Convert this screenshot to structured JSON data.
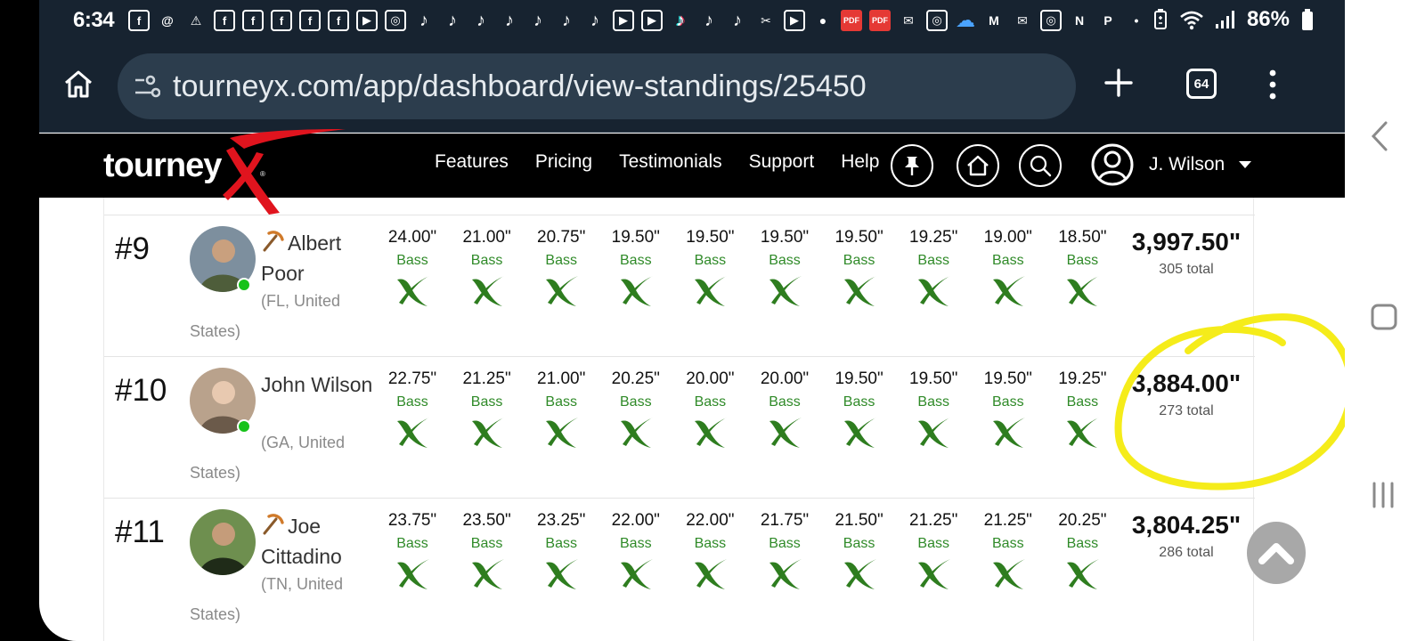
{
  "status_bar": {
    "time": "6:34",
    "battery_percent": "86%",
    "notification_icons": [
      "facebook-icon",
      "threads-icon",
      "warning-icon",
      "facebook-icon",
      "facebook-icon",
      "facebook-icon",
      "facebook-icon",
      "facebook-icon",
      "youtube-icon",
      "instagram-icon",
      "tiktok-icon",
      "tiktok-icon",
      "tiktok-icon",
      "tiktok-icon",
      "tiktok-icon",
      "tiktok-icon",
      "tiktok-icon",
      "youtube-icon",
      "youtube-icon",
      "tiktok-icon",
      "tiktok-icon",
      "tiktok-icon",
      "capcut-icon",
      "youtube-icon",
      "account-icon",
      "pdf-icon",
      "pdf-icon",
      "messenger-icon",
      "instagram-icon",
      "cloud-icon",
      "gmail-icon",
      "messenger-icon",
      "instagram-icon",
      "netflix-icon",
      "paypal-icon",
      "dot-icon"
    ]
  },
  "browser": {
    "url": "tourneyx.com/app/dashboard/view-standings/25450",
    "tab_count": "64"
  },
  "site": {
    "logo_text": "tourney",
    "nav": [
      "Features",
      "Pricing",
      "Testimonials",
      "Support",
      "Help"
    ],
    "user_name": "J. Wilson"
  },
  "standings": [
    {
      "rank": "#9",
      "has_badge": true,
      "name": "Albert Poor",
      "location_line1": "(FL, United",
      "location_line2": "States)",
      "online": true,
      "catches": [
        {
          "length": "24.00\"",
          "species": "Bass"
        },
        {
          "length": "21.00\"",
          "species": "Bass"
        },
        {
          "length": "20.75\"",
          "species": "Bass"
        },
        {
          "length": "19.50\"",
          "species": "Bass"
        },
        {
          "length": "19.50\"",
          "species": "Bass"
        },
        {
          "length": "19.50\"",
          "species": "Bass"
        },
        {
          "length": "19.50\"",
          "species": "Bass"
        },
        {
          "length": "19.25\"",
          "species": "Bass"
        },
        {
          "length": "19.00\"",
          "species": "Bass"
        },
        {
          "length": "18.50\"",
          "species": "Bass"
        }
      ],
      "total_length": "3,997.50\"",
      "total_count": "305 total"
    },
    {
      "rank": "#10",
      "has_badge": false,
      "name": "John Wilson",
      "location_line1": "(GA, United",
      "location_line2": "States)",
      "online": true,
      "catches": [
        {
          "length": "22.75\"",
          "species": "Bass"
        },
        {
          "length": "21.25\"",
          "species": "Bass"
        },
        {
          "length": "21.00\"",
          "species": "Bass"
        },
        {
          "length": "20.25\"",
          "species": "Bass"
        },
        {
          "length": "20.00\"",
          "species": "Bass"
        },
        {
          "length": "20.00\"",
          "species": "Bass"
        },
        {
          "length": "19.50\"",
          "species": "Bass"
        },
        {
          "length": "19.50\"",
          "species": "Bass"
        },
        {
          "length": "19.50\"",
          "species": "Bass"
        },
        {
          "length": "19.25\"",
          "species": "Bass"
        }
      ],
      "total_length": "3,884.00\"",
      "total_count": "273 total"
    },
    {
      "rank": "#11",
      "has_badge": true,
      "name": "Joe Cittadino",
      "location_line1": "(TN, United",
      "location_line2": "States)",
      "online": false,
      "catches": [
        {
          "length": "23.75\"",
          "species": "Bass"
        },
        {
          "length": "23.50\"",
          "species": "Bass"
        },
        {
          "length": "23.25\"",
          "species": "Bass"
        },
        {
          "length": "22.00\"",
          "species": "Bass"
        },
        {
          "length": "22.00\"",
          "species": "Bass"
        },
        {
          "length": "21.75\"",
          "species": "Bass"
        },
        {
          "length": "21.50\"",
          "species": "Bass"
        },
        {
          "length": "21.25\"",
          "species": "Bass"
        },
        {
          "length": "21.25\"",
          "species": "Bass"
        },
        {
          "length": "20.25\"",
          "species": "Bass"
        }
      ],
      "total_length": "3,804.25\"",
      "total_count": "286 total"
    }
  ],
  "colors": {
    "status_bar_bg": "#172330",
    "url_bar_bg": "#2c3d4d",
    "site_header_bg": "#000000",
    "logo_accent": "#e0141e",
    "species_green": "#2f8a28",
    "catch_x_green": "#2e7d1f",
    "online_dot": "#17c21a",
    "annotation_yellow": "#f5ec1a"
  }
}
